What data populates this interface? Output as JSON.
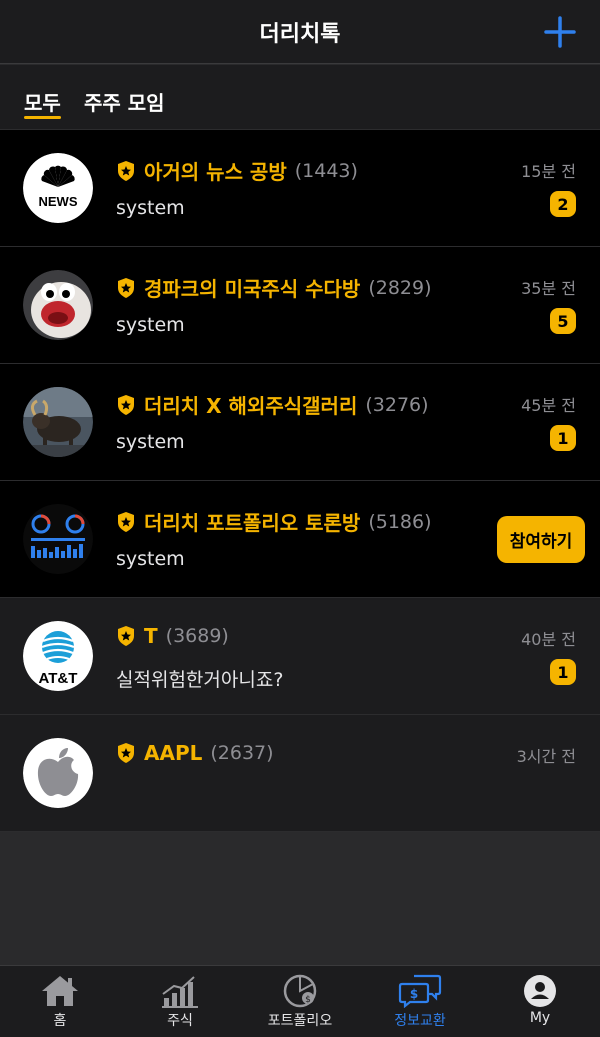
{
  "header": {
    "title": "더리치톡"
  },
  "tabs": [
    {
      "label": "모두",
      "active": true
    },
    {
      "label": "주주 모임",
      "active": false
    }
  ],
  "rooms": [
    {
      "name": "아거의 뉴스 공방",
      "count": "(1443)",
      "last_message": "system",
      "time": "15분 전",
      "unread": "2",
      "avatar": "news-logo"
    },
    {
      "name": "경파크의 미국주식 수다방",
      "count": "(2829)",
      "last_message": "system",
      "time": "35분 전",
      "unread": "5",
      "avatar": "penguin-avatar"
    },
    {
      "name": "더리치 X 해외주식갤러리",
      "count": "(3276)",
      "last_message": "system",
      "time": "45분 전",
      "unread": "1",
      "avatar": "bull-avatar"
    },
    {
      "name": "더리치 포트폴리오 토론방",
      "count": "(5186)",
      "last_message": "system",
      "join_label": "참여하기",
      "avatar": "portfolio-avatar"
    },
    {
      "name": "T",
      "count": "(3689)",
      "last_message": "실적위험한거아니죠?",
      "time": "40분 전",
      "unread": "1",
      "avatar": "att-logo"
    },
    {
      "name": "AAPL",
      "count": "(2637)",
      "last_message": "",
      "time": "3시간 전",
      "avatar": "apple-logo"
    }
  ],
  "tabbar": [
    {
      "label": "홈",
      "icon": "home-icon",
      "active": false
    },
    {
      "label": "주식",
      "icon": "chart-icon",
      "active": false
    },
    {
      "label": "포트폴리오",
      "icon": "portfolio-icon",
      "active": false
    },
    {
      "label": "정보교환",
      "icon": "chat-icon",
      "active": true
    },
    {
      "label": "My",
      "icon": "user-icon",
      "active": false
    }
  ],
  "colors": {
    "accent": "#f5b400",
    "active_tab": "#2f80ed",
    "background": "#000000"
  }
}
